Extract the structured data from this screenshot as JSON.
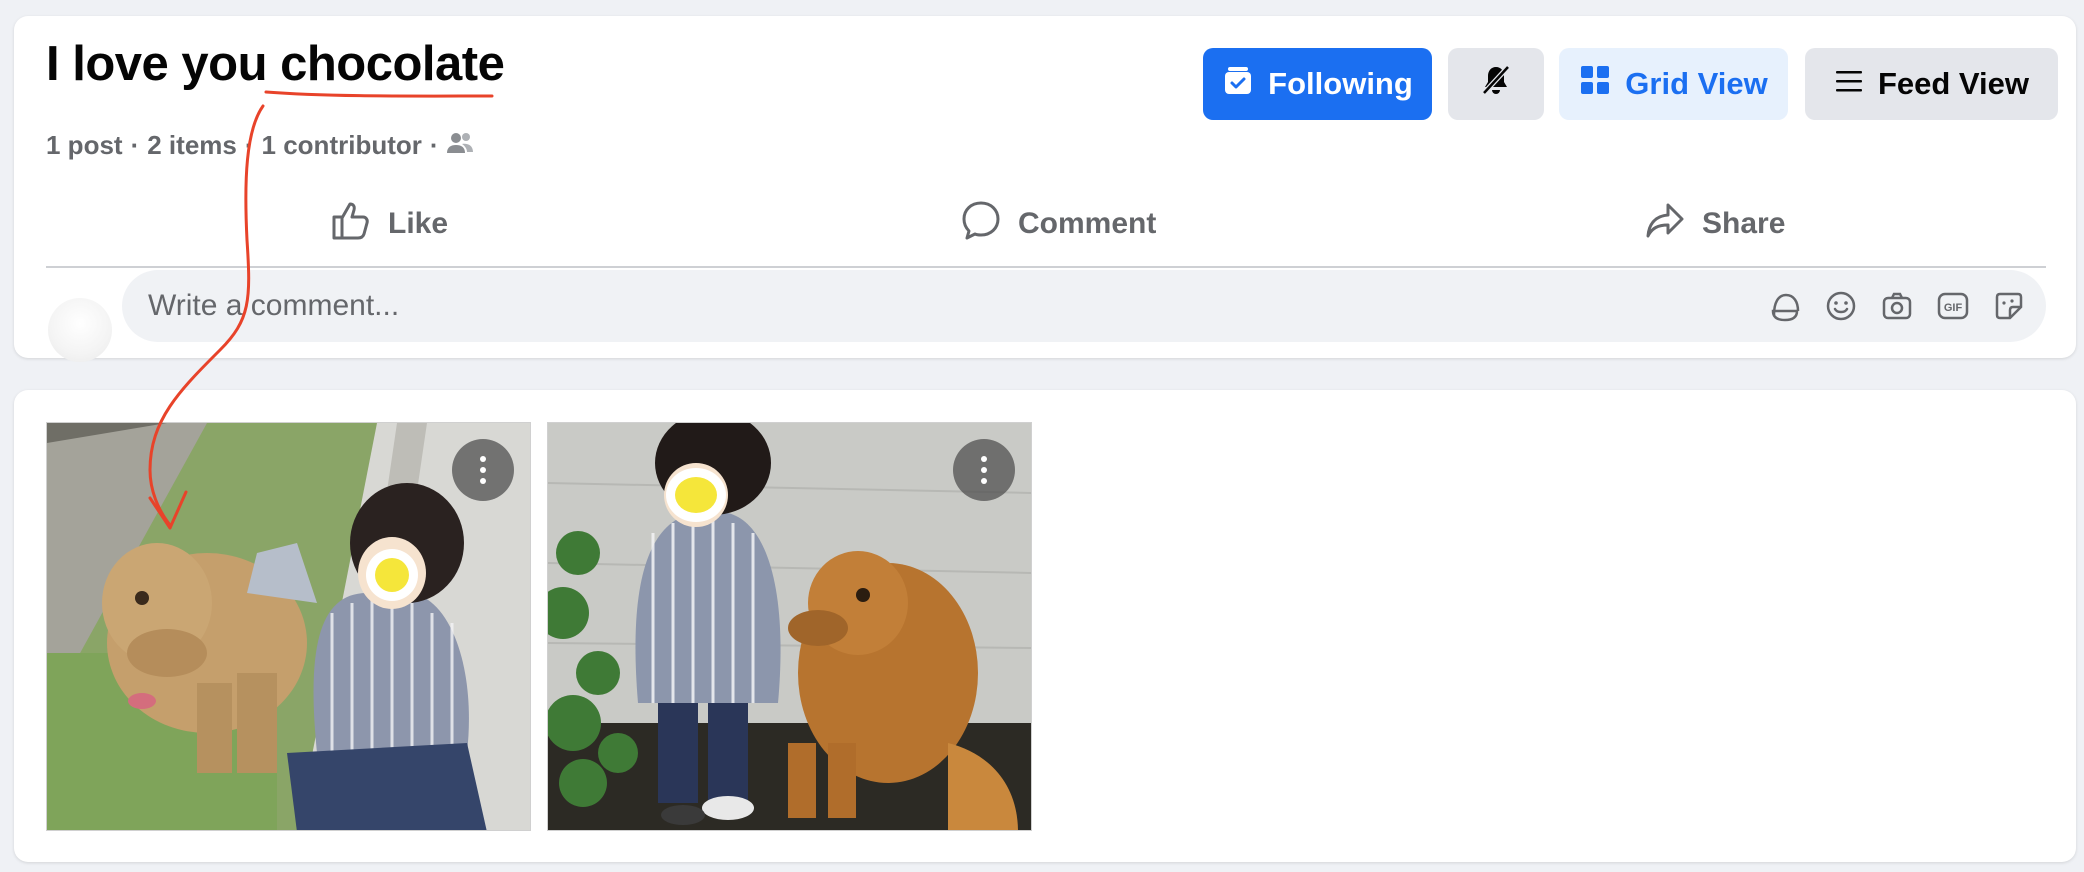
{
  "header": {
    "title_prefix": "I love you ",
    "title_highlight": "chocolate",
    "meta": {
      "posts": "1 post",
      "items": "2 items",
      "contributors": "1 contributor",
      "separator": "·",
      "people_icon": "people-icon"
    },
    "buttons": {
      "following": "Following",
      "mute_icon": "bell-slash-icon",
      "grid_view": "Grid View",
      "feed_view": "Feed View"
    }
  },
  "actions": {
    "like": "Like",
    "comment": "Comment",
    "share": "Share"
  },
  "comment_box": {
    "placeholder": "Write a comment...",
    "tools": [
      "avatar-sticker-icon",
      "emoji-icon",
      "camera-icon",
      "gif-icon",
      "sticker-icon"
    ],
    "gif_label": "GIF"
  },
  "photos": [
    {
      "description_icon": "photo-dog-child-grass-icon"
    },
    {
      "description_icon": "photo-child-dog-wall-icon"
    }
  ],
  "colors": {
    "accent": "#1b6ff1",
    "annotation": "#e8432a",
    "face_blur": "#f5e63a"
  }
}
